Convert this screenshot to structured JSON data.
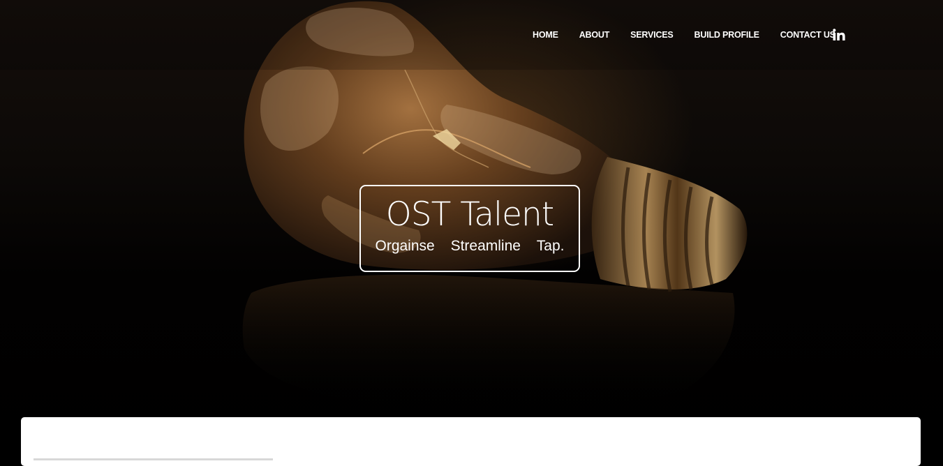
{
  "nav": {
    "items": [
      {
        "label": "HOME"
      },
      {
        "label": "ABOUT"
      },
      {
        "label": "SERVICES"
      },
      {
        "label": "BUILD PROFILE"
      },
      {
        "label": "CONTACT US"
      }
    ],
    "social_icon": "linkedin-icon"
  },
  "hero": {
    "title": "OST Talent",
    "tagline": [
      "Orgainse",
      "Streamline",
      "Tap."
    ],
    "background_image": "light-bulb"
  },
  "colors": {
    "text": "#ffffff",
    "background": "#000000",
    "card": "#ffffff",
    "bulb_glow": "#8a5a2a"
  }
}
